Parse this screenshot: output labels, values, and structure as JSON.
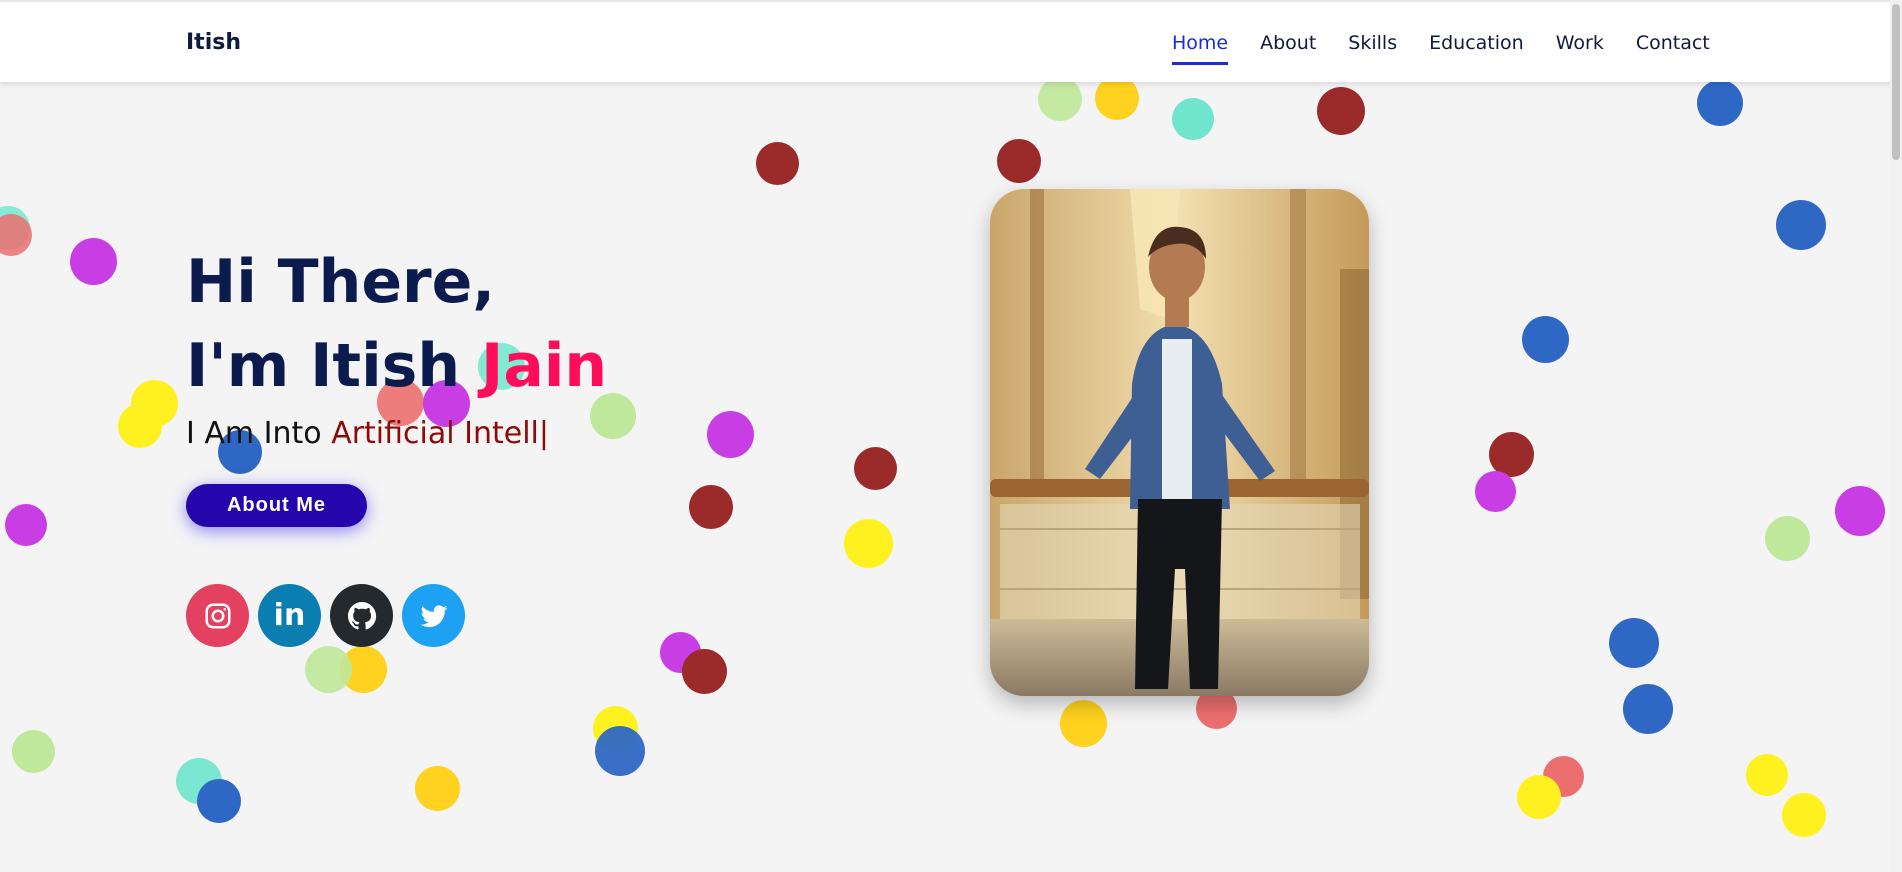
{
  "navbar": {
    "logo": "Itish",
    "links": [
      {
        "label": "Home",
        "active": true
      },
      {
        "label": "About",
        "active": false
      },
      {
        "label": "Skills",
        "active": false
      },
      {
        "label": "Education",
        "active": false
      },
      {
        "label": "Work",
        "active": false
      },
      {
        "label": "Contact",
        "active": false
      }
    ]
  },
  "hero": {
    "greeting": "Hi There,",
    "name_prefix": "I'm Itish ",
    "name_accent": "Jain",
    "typing_prefix": "I Am Into ",
    "typing_text": "Artificial Intell|",
    "button_label": "About Me",
    "photo_alt": "Portrait photo",
    "socials": [
      {
        "icon": "instagram-icon",
        "color": "#e4405f"
      },
      {
        "icon": "linkedin-icon",
        "text": "in",
        "color": "#0a7eb1"
      },
      {
        "icon": "github-icon",
        "color": "#24292e"
      },
      {
        "icon": "twitter-icon",
        "color": "#1da1f2"
      }
    ]
  },
  "colors": {
    "accent": "#1a2ad6",
    "name_accent": "#ff0d5a",
    "typed_text": "#8b0b0b",
    "button": "#2506ad",
    "heading": "#0b1b4d"
  }
}
